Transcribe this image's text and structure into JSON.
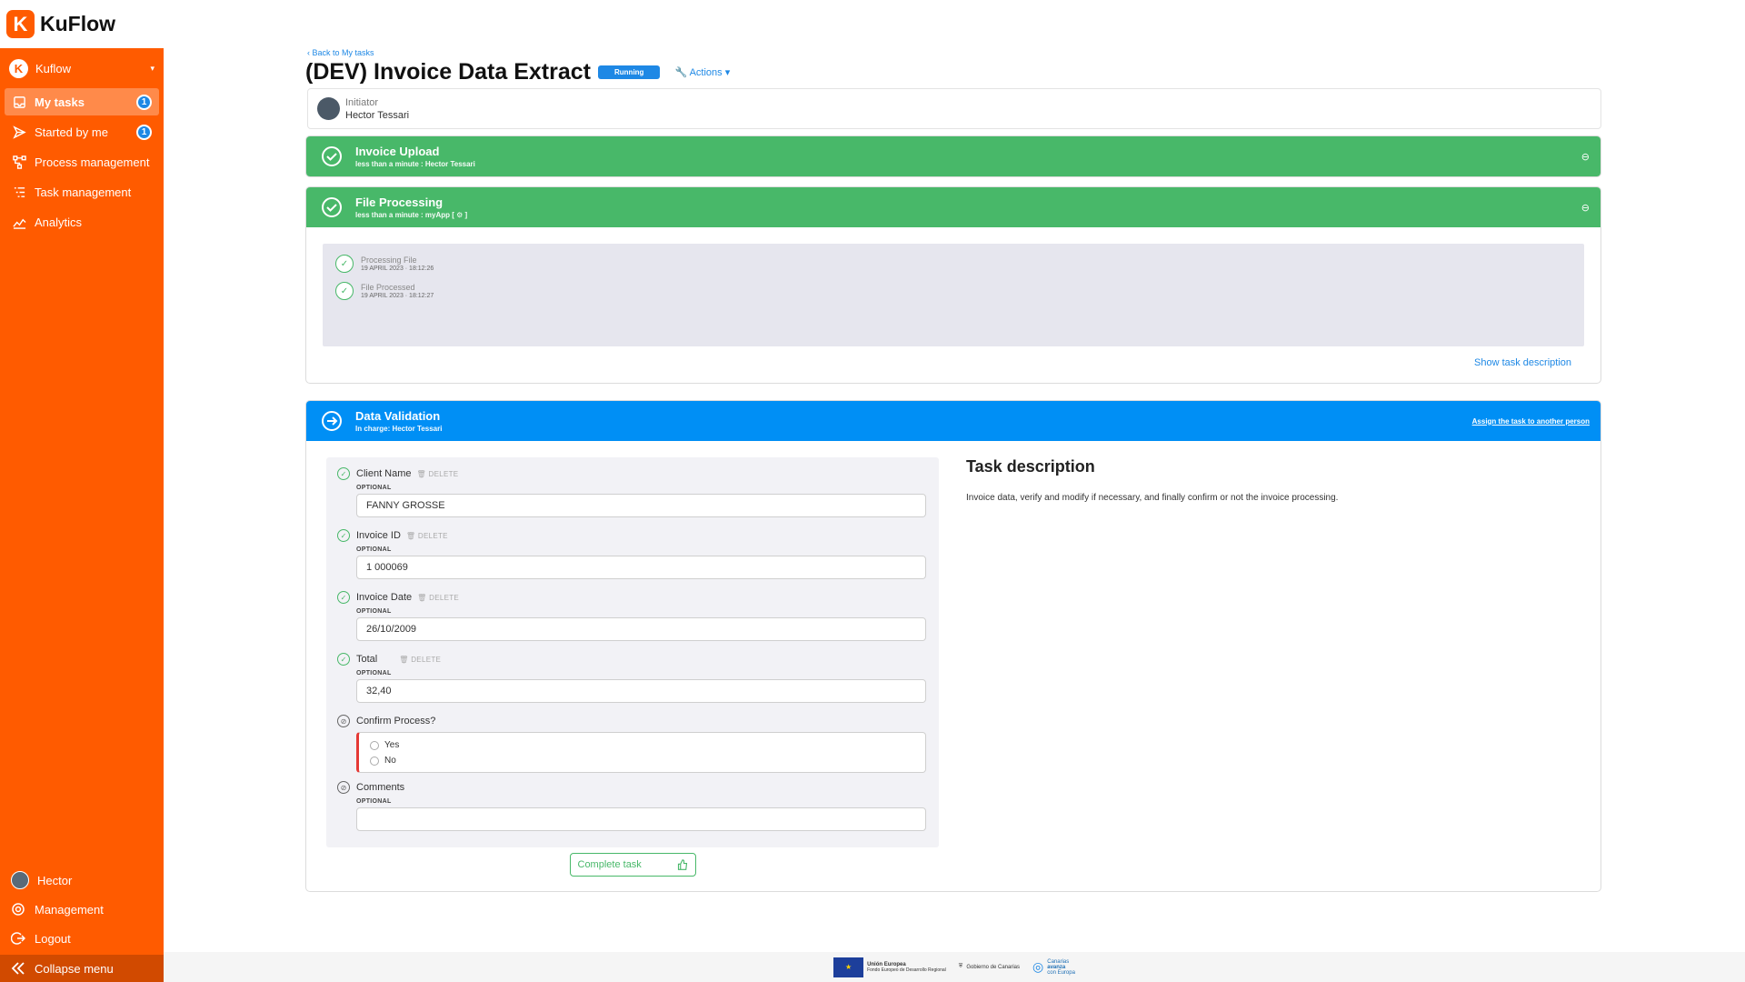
{
  "app": {
    "name": "KuFlow",
    "logo_letter": "K"
  },
  "sidebar": {
    "org": {
      "name": "Kuflow",
      "caret": "▾"
    },
    "items": [
      {
        "label": "My tasks",
        "badge": "1"
      },
      {
        "label": "Started by me",
        "badge": "1"
      },
      {
        "label": "Process management"
      },
      {
        "label": "Task management"
      },
      {
        "label": "Analytics"
      }
    ],
    "bottom": [
      {
        "label": "Hector"
      },
      {
        "label": "Management"
      },
      {
        "label": "Logout"
      },
      {
        "label": "Collapse menu"
      }
    ]
  },
  "header": {
    "back_link": "‹ Back to My tasks",
    "title": "(DEV) Invoice Data Extract",
    "status": "Running",
    "actions": "Actions ▾"
  },
  "initiator": {
    "label": "Initiator",
    "name": "Hector Tessari"
  },
  "tasks": {
    "upload": {
      "title": "Invoice Upload",
      "subtitle": "less than a minute : Hector Tessari",
      "toggle": "⊖"
    },
    "processing": {
      "title": "File Processing",
      "subtitle": "less than a minute : myApp [ ⚙ ]",
      "toggle": "⊖",
      "timeline": [
        {
          "title": "Processing File",
          "date": "19 APRIL 2023 · 18:12:26"
        },
        {
          "title": "File Processed",
          "date": "19 APRIL 2023 · 18:12:27"
        }
      ],
      "show_description": "Show task description"
    },
    "validation": {
      "title": "Data Validation",
      "subtitle": "In charge: Hector Tessari",
      "assign": "Assign the task to another person",
      "delete_label": "🗑 DELETE",
      "optional_label": "OPTIONAL",
      "fields": [
        {
          "label": "Client Name",
          "value": "FANNY GROSSE"
        },
        {
          "label": "Invoice ID",
          "value": "1 000069"
        },
        {
          "label": "Invoice Date",
          "value": "26/10/2009"
        },
        {
          "label": "Total",
          "value": "32,40"
        }
      ],
      "confirm": {
        "label": "Confirm Process?",
        "options": [
          "Yes",
          "No"
        ]
      },
      "comments": {
        "label": "Comments",
        "value": ""
      },
      "complete_button": "Complete task",
      "description_title": "Task description",
      "description_text": "Invoice data, verify and modify if necessary, and finally confirm or not the invoice processing."
    }
  },
  "footer": {
    "eu_label": "Unión Europea",
    "eu_sub": "Fondo Europeo de Desarrollo Regional",
    "canarias_gov": "Gobierno de Canarias",
    "canarias_line1": "Canarias",
    "canarias_line2": "avanza",
    "canarias_line3": "con Europa"
  },
  "colors": {
    "brand": "#ff5b00",
    "success": "#48b869",
    "primary": "#008ff5",
    "danger": "#e53935"
  }
}
